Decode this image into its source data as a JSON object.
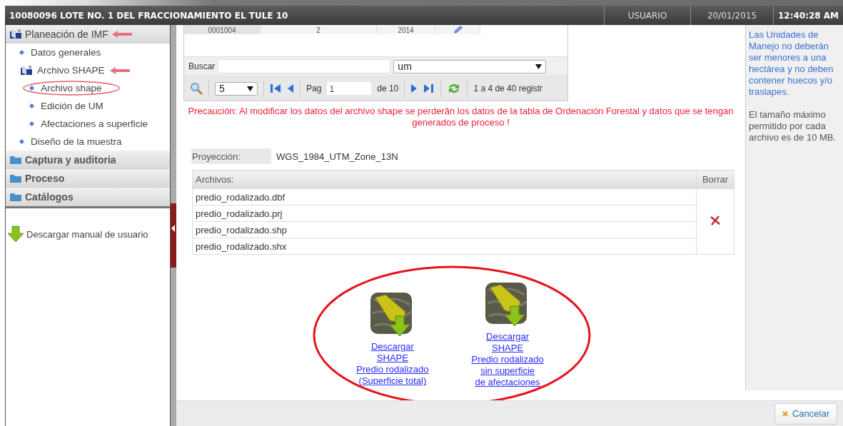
{
  "window": {
    "title": "10080096 LOTE NO. 1 DEL FRACCIONAMIENTO EL TULE 10",
    "user": "USUARIO",
    "date": "20/01/2015",
    "time": "12:40:28 AM"
  },
  "sidebar": {
    "sections": [
      {
        "label": "Planeación de IMF",
        "expanded": true,
        "marked": true,
        "children": [
          {
            "label": "Datos generales",
            "kind": "item"
          },
          {
            "label": "Archivo SHAPE",
            "kind": "folder",
            "marked": true,
            "children": [
              {
                "label": "Archivo shape",
                "kind": "item",
                "circled": true
              },
              {
                "label": "Edición de UM",
                "kind": "item"
              },
              {
                "label": "Afectaciones a superficie",
                "kind": "item"
              }
            ]
          },
          {
            "label": "Diseño de la muestra",
            "kind": "item"
          }
        ]
      },
      {
        "label": "Captura y auditoria",
        "expanded": false
      },
      {
        "label": "Proceso",
        "expanded": false
      },
      {
        "label": "Catálogos",
        "expanded": false
      }
    ],
    "manual_link": "Descargar manual de usuario"
  },
  "grid": {
    "partial_row": [
      "0001004",
      "2",
      "2014"
    ],
    "search": {
      "label": "Buscar",
      "field": "um"
    },
    "pager": {
      "page_size": "5",
      "page_label": "Pag",
      "page": "1",
      "page_total": "de 10",
      "records": "1 a 4 de 40 registr"
    }
  },
  "warning": "Precaución: Al modificar los datos del archivo shape se perderân los datos de la tabla de Ordenación Forestal y datos que se tengan generados de proceso !",
  "projection": {
    "label": "Proyección:",
    "value": "WGS_1984_UTM_Zone_13N"
  },
  "files": {
    "columns": [
      "Archivos:",
      "Borrar"
    ],
    "rows": [
      "predio_rodalizado.dbf",
      "predio_rodalizado.prj",
      "predio_rodalizado.shp",
      "predio_rodalizado.shx"
    ]
  },
  "downloads": {
    "circled": true,
    "items": [
      {
        "lines": [
          "Descargar",
          "SHAPE",
          "Predio rodalizado",
          "(Superficie total)"
        ]
      },
      {
        "lines": [
          "Descargar",
          "SHAPE",
          "Predio rodalizado",
          "sin superficie",
          "de afectaciones"
        ]
      }
    ]
  },
  "info": [
    {
      "kind": "hint",
      "text": "Las Unidades de Manejo no deberán ser menores a una hectárea y no deben contener huecos y/o traslapes."
    },
    {
      "kind": "rule",
      "text": "El tamaño máximo permitido por cada archivo es de 10 MB."
    }
  ],
  "footer": {
    "cancel": "Cancelar"
  }
}
